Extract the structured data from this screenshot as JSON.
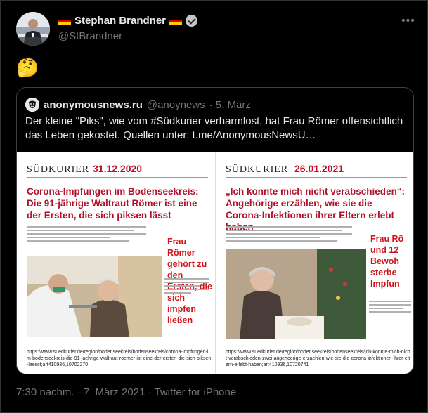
{
  "author": {
    "name": "Stephan Brandner",
    "handle": "@StBrandner",
    "flag_icon": "german-flag-emoji",
    "verified_icon": "verified-badge-icon"
  },
  "tweet": {
    "emoji": "🤔",
    "footer": "7:30 nachm. · 7. März 2021 · Twitter for iPhone"
  },
  "quoted": {
    "avatar_glyph": "🎭",
    "name": "anonymousnews.ru",
    "handle": "@anoynews",
    "date": "· 5. März",
    "text": "Der kleine \"Piks\", wie vom #Südkurier verharmlost, hat Frau Römer offensichtlich das Leben gekostet. Quellen unter: t.me/AnonymousNewsU…",
    "left_article": {
      "brand": "SÜDKURIER",
      "date": "31.12.2020",
      "headline": "Corona-Impfungen im Bodenseekreis: Die 91-jährige Waltraut Römer ist eine der Ersten, die sich piksen lässt",
      "red_note": "Frau Römer gehört zu den Ersten, die sich impfen ließen",
      "url": "https://www.suedkurier.de/region/bodenseekreis/bodenseekreis/corona-impfungen-im-bodenseekreis-die-91-jaehrige-waltraut-roemer-ist-eine-der-ersten-die-sich-piksen-laesst;art410936,10702270"
    },
    "right_article": {
      "brand": "SÜDKURIER",
      "date": "26.01.2021",
      "headline": "„Ich konnte mich nicht verabschieden“: Angehörige erzählen, wie sie die Corona-Infektionen ihrer Eltern erlebt haben",
      "red_note": "Frau Rö\nund 12\nBewoh\nsterbe\nImpfun",
      "url": "https://www.suedkurier.de/region/bodenseekreis/bodenseekreis/ich-konnte-mich-nicht-verabschieden-zwei-angehoerige-erzaehlen-wie-sie-die-corona-infektionen-ihrer-eltern-erlebt-haben;art410936,10720741"
    }
  },
  "colors": {
    "background": "#000000",
    "text": "#e7e9ea",
    "muted": "#71767b",
    "border": "#2f3336",
    "newspaper_red": "#c30d24"
  }
}
